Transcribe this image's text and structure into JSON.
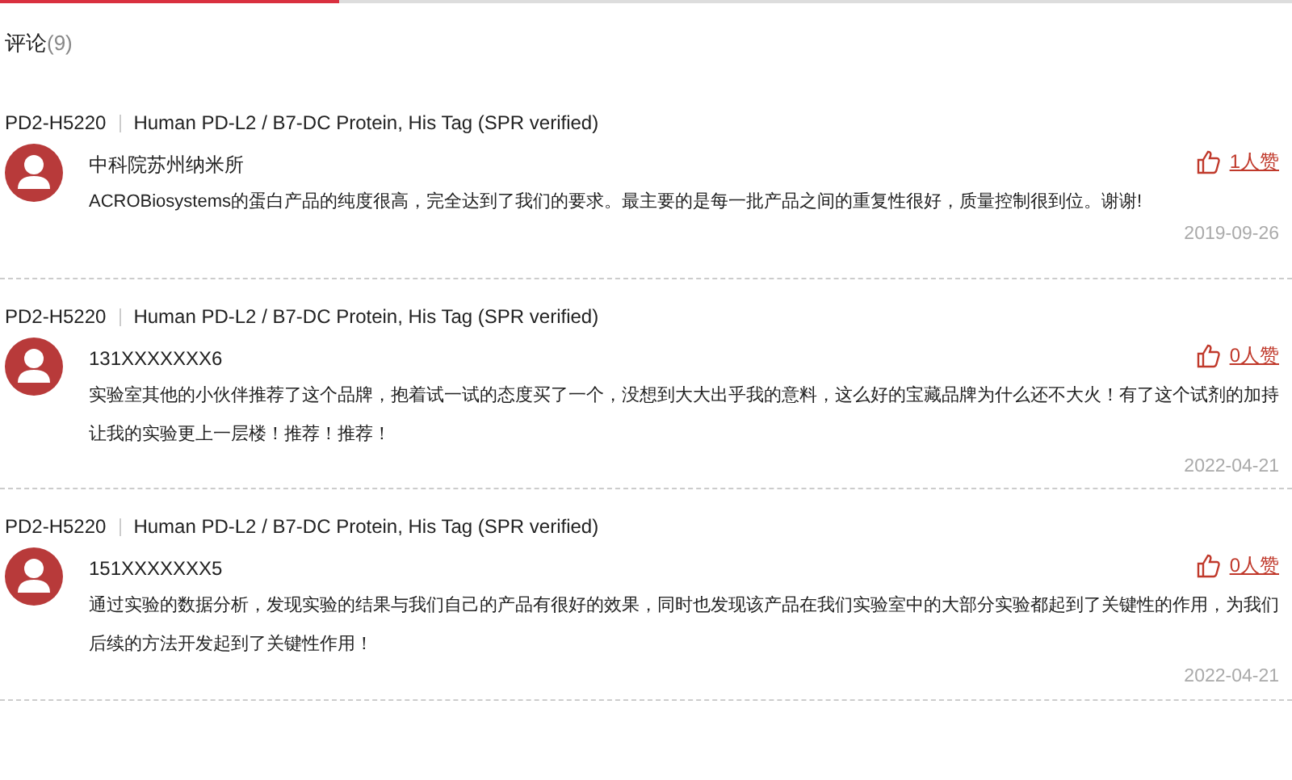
{
  "section": {
    "title": "评论",
    "count": "(9)"
  },
  "comments": [
    {
      "sku": "PD2-H5220",
      "product": "Human PD-L2 / B7-DC Protein, His Tag (SPR verified)",
      "user": "中科院苏州纳米所",
      "likes": "1人赞",
      "text": "ACROBiosystems的蛋白产品的纯度很高，完全达到了我们的要求。最主要的是每一批产品之间的重复性很好，质量控制很到位。谢谢!",
      "date": "2019-09-26"
    },
    {
      "sku": "PD2-H5220",
      "product": "Human PD-L2 / B7-DC Protein, His Tag (SPR verified)",
      "user": "131XXXXXXX6",
      "likes": "0人赞",
      "text": "实验室其他的小伙伴推荐了这个品牌，抱着试一试的态度买了一个，没想到大大出乎我的意料，这么好的宝藏品牌为什么还不大火！有了这个试剂的加持让我的实验更上一层楼！推荐！推荐！",
      "date": "2022-04-21"
    },
    {
      "sku": "PD2-H5220",
      "product": "Human PD-L2 / B7-DC Protein, His Tag (SPR verified)",
      "user": "151XXXXXXX5",
      "likes": "0人赞",
      "text": "通过实验的数据分析，发现实验的结果与我们自己的产品有很好的效果，同时也发现该产品在我们实验室中的大部分实验都起到了关键性的作用，为我们后续的方法开发起到了关键性作用！",
      "date": "2022-04-21"
    }
  ]
}
